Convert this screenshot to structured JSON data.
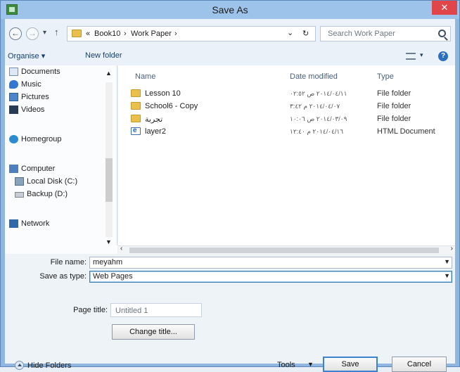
{
  "window": {
    "title": "Save As",
    "close_glyph": "✕"
  },
  "nav": {
    "back_glyph": "←",
    "forward_glyph": "→",
    "recent_glyph": "▾",
    "up_glyph": "↑",
    "crumb_prefix": "«",
    "crumbs": [
      "Book10",
      "Work Paper"
    ],
    "crumb_sep": "›",
    "dropdown_glyph": "⌄",
    "refresh_glyph": "↻"
  },
  "search": {
    "placeholder": "Search Work Paper"
  },
  "toolbar": {
    "organise": "Organise ▾",
    "new_folder": "New folder",
    "help_glyph": "?"
  },
  "sidebar": {
    "items": [
      {
        "label": "Documents",
        "icon": "documents-icon"
      },
      {
        "label": "Music",
        "icon": "music-icon"
      },
      {
        "label": "Pictures",
        "icon": "pictures-icon"
      },
      {
        "label": "Videos",
        "icon": "videos-icon"
      },
      {
        "label": "Homegroup",
        "icon": "homegroup-icon"
      },
      {
        "label": "Computer",
        "icon": "computer-icon"
      },
      {
        "label": "Local Disk (C:)",
        "icon": "local-disk-icon"
      },
      {
        "label": "Backup (D:)",
        "icon": "backup-disk-icon"
      },
      {
        "label": "Network",
        "icon": "network-icon"
      }
    ]
  },
  "files": {
    "columns": [
      "Name",
      "Date modified",
      "Type"
    ],
    "rows": [
      {
        "name": "Lesson 10",
        "date": "٢٠١٤/٠٤/١١ ص ٠٢:٥٢",
        "type": "File folder"
      },
      {
        "name": "School6 - Copy",
        "date": "٢٠١٤/٠٤/٠٧ م ٣:٤٢",
        "type": "File folder"
      },
      {
        "name": "تجربة",
        "date": "٢٠١٤/٠٣/٠٩ ص ١٠:٠٦",
        "type": "File folder"
      },
      {
        "name": "layer2",
        "date": "٢٠١٤/٠٤/١٦ م ١٢:٤٠",
        "type": "HTML Document"
      }
    ]
  },
  "form": {
    "file_name_label": "File name:",
    "file_name_value": "meyahm",
    "save_type_label": "Save as type:",
    "save_type_value": "Web Pages",
    "page_title_label": "Page title:",
    "page_title_value": "Untitled 1",
    "change_title": "Change title..."
  },
  "footer": {
    "hide_folders": "Hide Folders",
    "tools": "Tools",
    "save": "Save",
    "cancel": "Cancel"
  }
}
